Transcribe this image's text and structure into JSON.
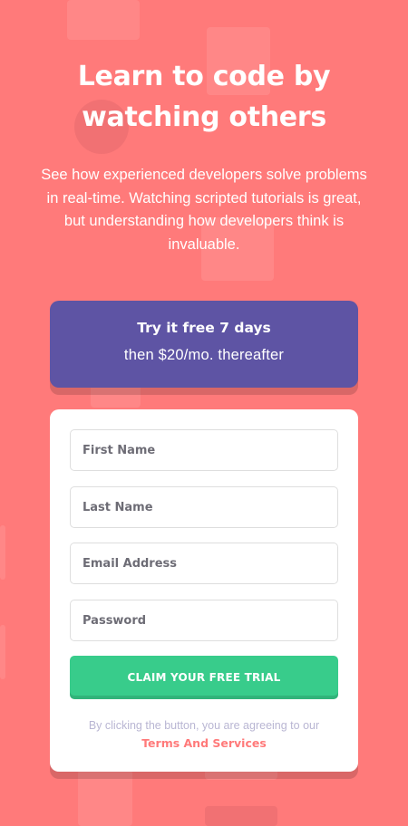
{
  "hero": {
    "title": "Learn to code by watching others",
    "text": "See how experienced developers solve problems in real-time. Watching scripted tutorials is great, but understanding how developers think is invaluable."
  },
  "trial": {
    "strong": "Try it free 7 days",
    "light": "then $20/mo. thereafter"
  },
  "form": {
    "first_name_placeholder": "First Name",
    "last_name_placeholder": "Last Name",
    "email_placeholder": "Email Address",
    "password_placeholder": "Password",
    "submit_label": "CLAIM YOUR FREE TRIAL",
    "legal_text": "By clicking the button, you are agreeing to our",
    "terms_label": "Terms And Services"
  },
  "colors": {
    "background": "#ff7a7a",
    "trial_banner": "#5e54a4",
    "button": "#38cc8b",
    "card": "#ffffff",
    "terms_link": "#ff7a7a"
  }
}
